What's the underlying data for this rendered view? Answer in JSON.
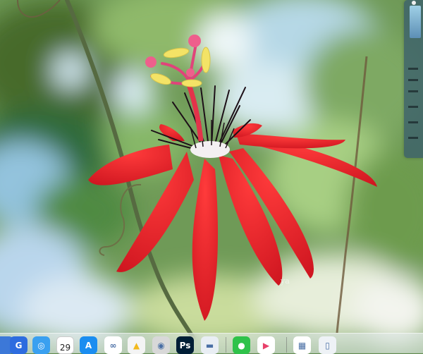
{
  "desktop": {
    "wallpaper_subject": "red passion flower",
    "watermark": "ya"
  },
  "dock": {
    "apps": [
      {
        "name": "finder-icon",
        "label": "",
        "bg": "#3c78d8"
      },
      {
        "name": "tencent-meeting-icon",
        "label": "G",
        "bg": "#2d6cdf"
      },
      {
        "name": "safari-icon",
        "label": "◎",
        "bg": "#3aa0f0"
      },
      {
        "name": "calendar-icon",
        "label": "29",
        "month": "",
        "bg": "#ffffff"
      },
      {
        "name": "app-store-icon",
        "label": "A",
        "bg": "#1b8df0"
      },
      {
        "name": "baidu-netdisk-icon",
        "label": "∞",
        "bg": "#ffffff"
      },
      {
        "name": "google-drive-icon",
        "label": "▲",
        "bg": "#f4f4f4"
      },
      {
        "name": "disk-utility-icon",
        "label": "◉",
        "bg": "#d8d8d8"
      },
      {
        "name": "photoshop-icon",
        "label": "Ps",
        "bg": "#001e36"
      },
      {
        "name": "storage-drive-icon",
        "label": "▬",
        "bg": "#e9eef4"
      },
      {
        "name": "wechat-icon",
        "label": "●",
        "bg": "#2fc24a"
      },
      {
        "name": "video-app-icon",
        "label": "▶",
        "bg": "#ffffff"
      },
      {
        "name": "preview-icon",
        "label": "▦",
        "bg": "#ffffff"
      },
      {
        "name": "trash-icon",
        "label": "▯",
        "bg": "#eef2f6"
      }
    ]
  },
  "colors": {
    "petal": "#e8262b",
    "stigma": "#f07aa8",
    "pollen": "#f1e06a",
    "stem": "#5b6f46"
  }
}
